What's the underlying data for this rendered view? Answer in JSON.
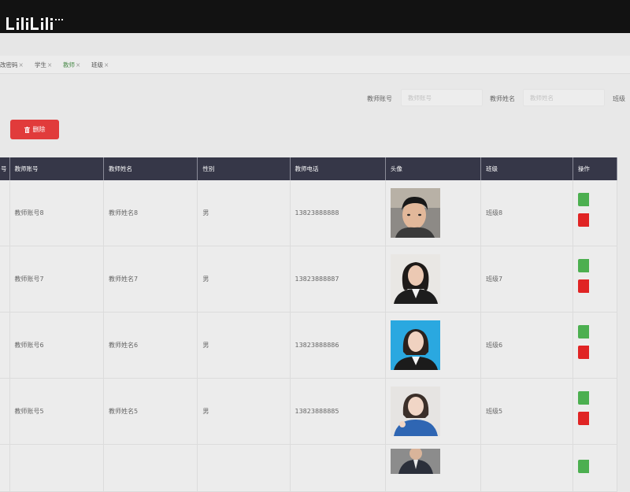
{
  "tabs": [
    {
      "label": "改密码",
      "close": "×"
    },
    {
      "label": "学生",
      "close": "×"
    },
    {
      "label": "教师",
      "close": "×",
      "active": true
    },
    {
      "label": "班级",
      "close": "×"
    }
  ],
  "search": {
    "account_label": "教师账号",
    "account_placeholder": "教师账号",
    "name_label": "教师姓名",
    "name_placeholder": "教师姓名",
    "class_label": "班级"
  },
  "toolbar": {
    "delete_label": "删除",
    "delete_color": "#e13b3b"
  },
  "table": {
    "header_color": "#363748",
    "columns": [
      "号",
      "教师账号",
      "教师姓名",
      "性别",
      "教师电话",
      "头像",
      "班级",
      "操作"
    ],
    "rows": [
      {
        "account": "教师账号8",
        "name": "教师姓名8",
        "gender": "男",
        "phone": "13823888888",
        "avatar": "avatar-man-dark-hair",
        "class": "班级8"
      },
      {
        "account": "教师账号7",
        "name": "教师姓名7",
        "gender": "男",
        "phone": "13823888887",
        "avatar": "avatar-woman-black-suit",
        "class": "班级7"
      },
      {
        "account": "教师账号6",
        "name": "教师姓名6",
        "gender": "男",
        "phone": "13823888886",
        "avatar": "avatar-woman-blue-background",
        "class": "班级6"
      },
      {
        "account": "教师账号5",
        "name": "教师姓名5",
        "gender": "男",
        "phone": "13823888885",
        "avatar": "avatar-woman-blue-shirt",
        "class": "班级5"
      }
    ],
    "partial_row_avatar": "avatar-man-suit",
    "action_colors": {
      "edit": "#4caf50",
      "delete": "#e02424"
    }
  },
  "logo": {
    "name": "bilibili-logo"
  }
}
